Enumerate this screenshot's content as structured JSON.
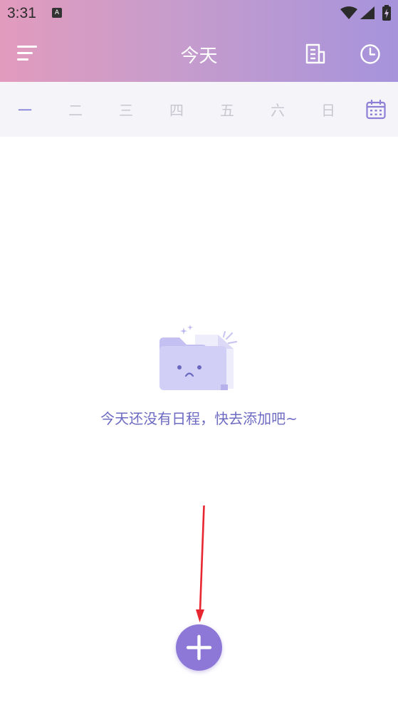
{
  "status_bar": {
    "time": "3:31",
    "notification_icon": "A"
  },
  "header": {
    "title": "今天"
  },
  "week": {
    "days": [
      "一",
      "二",
      "三",
      "四",
      "五",
      "六",
      "日"
    ],
    "active_index": 0
  },
  "empty_state": {
    "message": "今天还没有日程，快去添加吧~"
  },
  "colors": {
    "accent": "#7b79d6",
    "fab": "#8d78d8",
    "header_gradient_start": "#e29bbd",
    "header_gradient_end": "#a693dc",
    "annotation_arrow": "#e8262f"
  },
  "icons": {
    "menu": "menu-icon",
    "notes": "notes-icon",
    "clock": "clock-icon",
    "calendar": "calendar-icon",
    "add": "plus-icon",
    "empty": "empty-folder-illustration"
  }
}
